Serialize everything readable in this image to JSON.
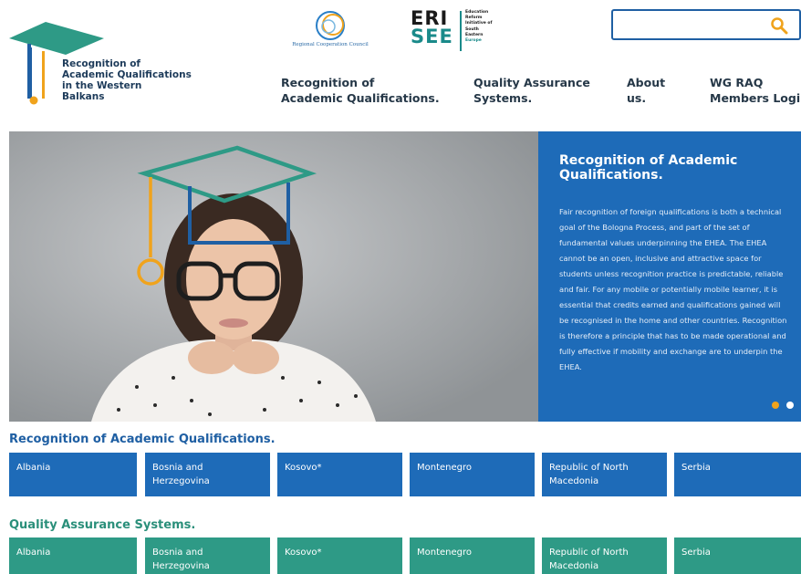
{
  "header": {
    "logo": {
      "lines": [
        "Recognition of",
        "Academic Qualifications",
        "in the Western",
        "Balkans"
      ]
    },
    "partners": {
      "rcc_name": "Regional Cooperation Council",
      "erisee_big": [
        "ERI",
        "SEE"
      ],
      "erisee_small": [
        "Education",
        "Reform",
        "Initiative of",
        "South",
        "Eastern",
        "Europe"
      ]
    },
    "search": {
      "value": "",
      "placeholder": ""
    },
    "nav": [
      {
        "lines": [
          "Recognition of",
          "Academic Qualifications."
        ]
      },
      {
        "lines": [
          "Quality Assurance",
          "Systems."
        ]
      },
      {
        "lines": [
          "About",
          "us."
        ]
      },
      {
        "lines": [
          "WG RAQ",
          "Members Login"
        ]
      }
    ]
  },
  "hero": {
    "title": "Recognition of Academic Qualifications.",
    "body": "Fair recognition of foreign qualifications is both a technical goal of the Bologna Process, and part of the set of fundamental values underpinning the EHEA. The EHEA cannot be an open, inclusive and attractive space for students unless recognition practice is predictable, reliable and fair. For any mobile or potentially mobile learner, it is essential that credits earned and qualifications gained will be recognised in the home and other countries. Recognition is therefore a principle that has to be made operational and fully effective if mobility and exchange are to underpin the EHEA.",
    "slides": 2,
    "active_slide": 1
  },
  "sections": [
    {
      "title": "Recognition of Academic Qualifications.",
      "tiles": [
        {
          "lines": [
            "Albania"
          ]
        },
        {
          "lines": [
            "Bosnia and",
            "Herzegovina"
          ]
        },
        {
          "lines": [
            "Kosovo*"
          ]
        },
        {
          "lines": [
            "Montenegro"
          ]
        },
        {
          "lines": [
            "Republic of North",
            "Macedonia"
          ]
        },
        {
          "lines": [
            "Serbia"
          ]
        }
      ]
    },
    {
      "title": "Quality Assurance Systems.",
      "tiles": [
        {
          "lines": [
            "Albania"
          ]
        },
        {
          "lines": [
            "Bosnia and",
            "Herzegovina"
          ]
        },
        {
          "lines": [
            "Kosovo*"
          ]
        },
        {
          "lines": [
            "Montenegro"
          ]
        },
        {
          "lines": [
            "Republic of North",
            "Macedonia"
          ]
        },
        {
          "lines": [
            "Serbia"
          ]
        }
      ]
    }
  ],
  "colors": {
    "brand_blue": "#1e6bb8",
    "brand_teal": "#2e9a86",
    "accent_orange": "#f0a31c",
    "title_blue": "#1f5fa3",
    "title_teal": "#2a8f7a"
  }
}
